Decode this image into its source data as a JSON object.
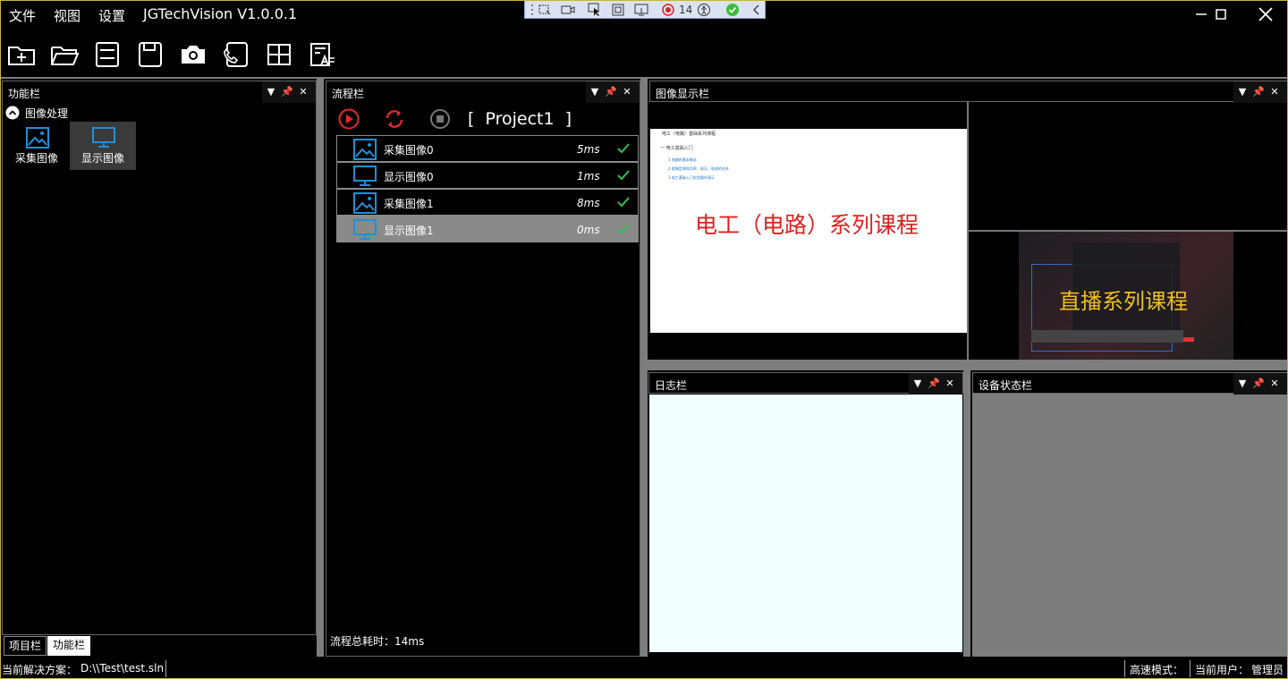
{
  "menu": {
    "file": "文件",
    "view": "视图",
    "settings": "设置",
    "app_title": "JGTechVision V1.0.0.1"
  },
  "window": {
    "minimize": "—",
    "maximize": "☐",
    "close": "✕"
  },
  "rec_bar": {
    "count": "14"
  },
  "function_panel": {
    "title": "功能栏",
    "group": "图像处理",
    "items": [
      {
        "label": "采集图像"
      },
      {
        "label": "显示图像"
      }
    ],
    "tabs": [
      "项目栏",
      "功能栏"
    ]
  },
  "flow_panel": {
    "title": "流程栏",
    "project": "[  Project1  ]",
    "rows": [
      {
        "name": "采集图像0",
        "time": "5ms"
      },
      {
        "name": "显示图像0",
        "time": "1ms"
      },
      {
        "name": "采集图像1",
        "time": "8ms"
      },
      {
        "name": "显示图像1",
        "time": "0ms"
      }
    ],
    "total": "流程总耗时：14ms"
  },
  "image_panel": {
    "title": "图像显示栏",
    "doc_title": "电工（电路）系列课程",
    "doc_heading": "电工（电路）基础系列课程",
    "doc_section": "一 电工基础入门",
    "doc_lines": [
      "1 电路的基本概念",
      "2 欧姆定律和功率、电压、电流的关系",
      "3 电工基础入门实验操作演示"
    ],
    "live_title": "直播系列课程"
  },
  "log_panel": {
    "title": "日志栏"
  },
  "device_panel": {
    "title": "设备状态栏"
  },
  "status": {
    "solution_label": "当前解决方案：",
    "solution_path": "D:\\\\Test\\test.sln",
    "speed_mode": "高速模式：",
    "user_label": "当前用户：",
    "user": "管理员"
  },
  "colors": {
    "accent_blue": "#1e90d6",
    "run_red": "#e8262a",
    "check_green": "#2fbf54",
    "log_bg": "#f0ffff",
    "title_red": "#e02020",
    "live_gold": "#f0c020"
  }
}
